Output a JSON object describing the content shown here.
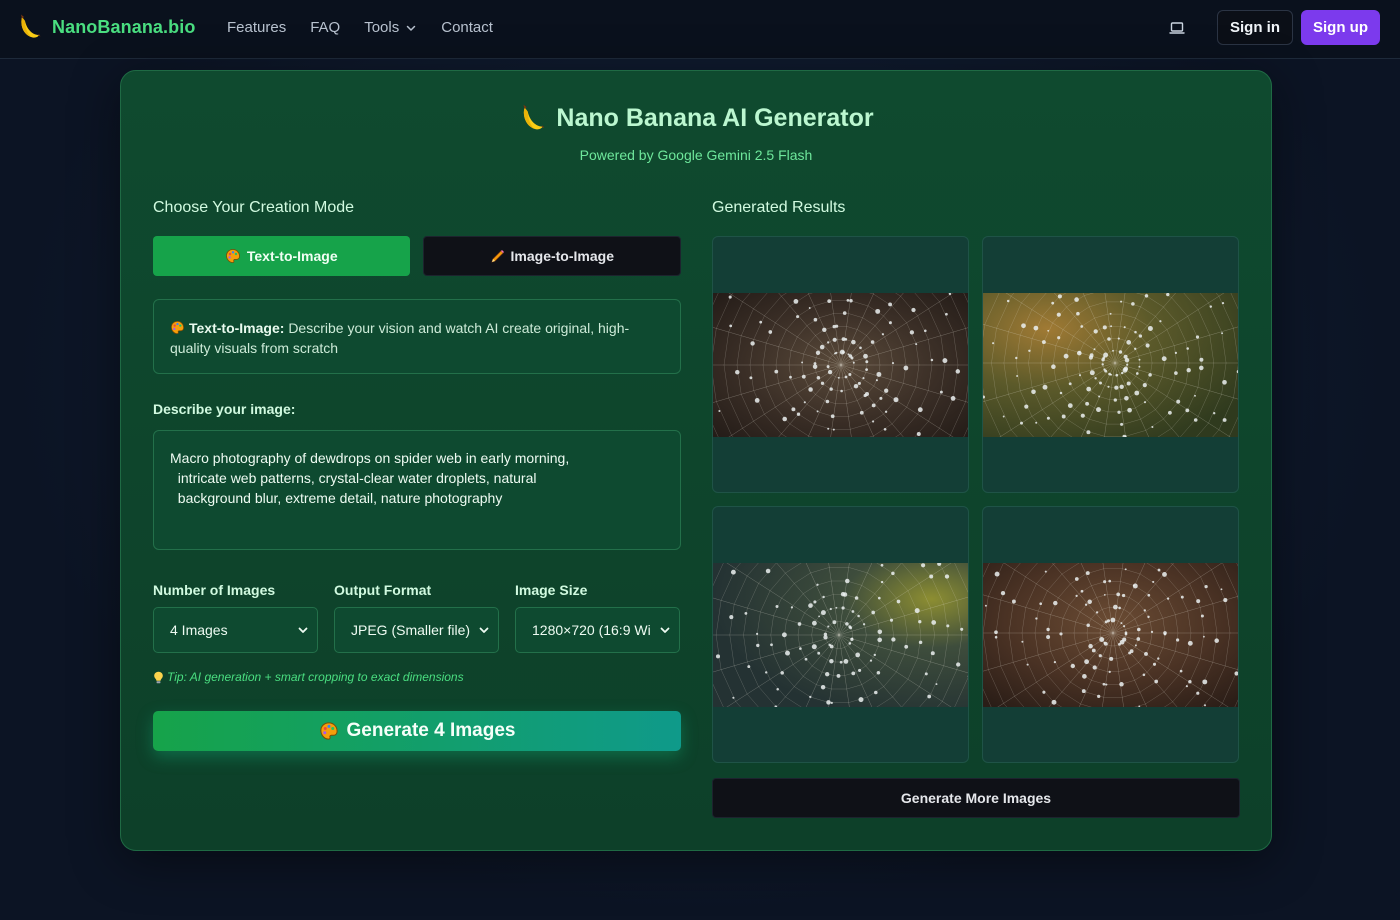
{
  "nav": {
    "brand": "NanoBanana.bio",
    "links": [
      {
        "label": "Features"
      },
      {
        "label": "FAQ"
      },
      {
        "label": "Tools",
        "has_dropdown": true
      },
      {
        "label": "Contact"
      }
    ],
    "signin": "Sign in",
    "signup": "Sign up",
    "brand_color": "#4ade80",
    "signup_color": "#7c3aed"
  },
  "header": {
    "title": "Nano Banana AI Generator",
    "subtitle": "Powered by Google Gemini 2.5 Flash"
  },
  "mode": {
    "label": "Choose Your Creation Mode",
    "tabs": [
      {
        "label": "Text-to-Image",
        "icon": "palette-icon",
        "active": true
      },
      {
        "label": "Image-to-Image",
        "icon": "pencil-icon",
        "active": false
      }
    ],
    "info_title": "Text-to-Image:",
    "info_text": "Describe your vision and watch AI create original, high-quality visuals from scratch"
  },
  "prompt": {
    "label": "Describe your image:",
    "value": "Macro photography of dewdrops on spider web in early morning,\n  intricate web patterns, crystal-clear water droplets, natural\n  background blur, extreme detail, nature photography"
  },
  "options": {
    "count": {
      "label": "Number of Images",
      "value": "4 Images"
    },
    "format": {
      "label": "Output Format",
      "value": "JPEG (Smaller file)"
    },
    "size": {
      "label": "Image Size",
      "value": "1280×720 (16:9 Wi"
    }
  },
  "tip": "Tip: AI generation + smart cropping to exact dimensions",
  "generate": "Generate 4 Images",
  "results": {
    "label": "Generated Results",
    "images": [
      {
        "name": "dewdrop spider web, brown background"
      },
      {
        "name": "dewdrop spider web, golden-green background"
      },
      {
        "name": "dewdrop spider web, blue-grey background"
      },
      {
        "name": "dewdrop spider web, warm brown background"
      }
    ],
    "more": "Generate More Images"
  }
}
